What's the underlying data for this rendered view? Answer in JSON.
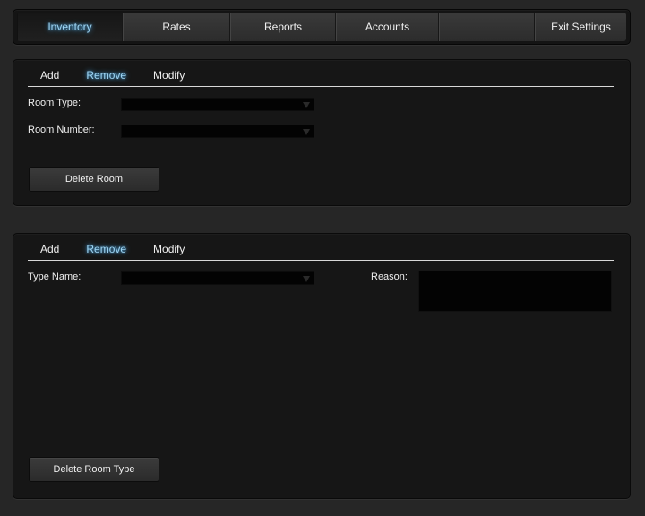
{
  "nav": {
    "items": [
      {
        "label": "Inventory",
        "active": true
      },
      {
        "label": "Rates"
      },
      {
        "label": "Reports"
      },
      {
        "label": "Accounts"
      },
      {
        "label": ""
      },
      {
        "label": "Exit Settings"
      }
    ]
  },
  "room_panel": {
    "tabs": {
      "add": "Add",
      "remove": "Remove",
      "modify": "Modify",
      "active": "Remove"
    },
    "room_type_label": "Room Type:",
    "room_type_value": "",
    "room_number_label": "Room Number:",
    "room_number_value": "",
    "delete_button": "Delete Room"
  },
  "type_panel": {
    "tabs": {
      "add": "Add",
      "remove": "Remove",
      "modify": "Modify",
      "active": "Remove"
    },
    "type_name_label": "Type Name:",
    "type_name_value": "",
    "reason_label": "Reason:",
    "reason_value": "",
    "delete_button": "Delete Room Type"
  },
  "colors": {
    "background": "#262626",
    "panel": "#161616",
    "active_glow": "#9ed4f2"
  }
}
